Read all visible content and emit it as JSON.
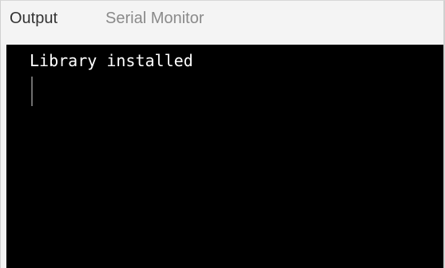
{
  "tabs": [
    {
      "label": "Output",
      "active": true
    },
    {
      "label": "Serial Monitor",
      "active": false
    }
  ],
  "console": {
    "lines": [
      "Library installed"
    ]
  },
  "colors": {
    "console_background": "#000000",
    "console_text": "#ffffff",
    "active_tab_text": "#333333",
    "inactive_tab_text": "#8a8a8a"
  }
}
